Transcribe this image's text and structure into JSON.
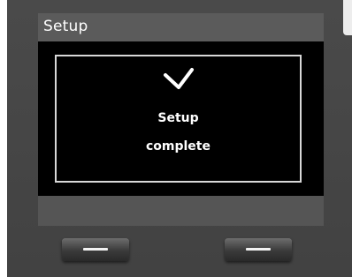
{
  "header": {
    "title": "Setup"
  },
  "dialog": {
    "icon": "checkmark-icon",
    "line1": "Setup",
    "line2": "complete"
  },
  "softkeys": {
    "left_icon": "minus-icon",
    "right_icon": "minus-icon"
  },
  "colors": {
    "display_bg": "#000000",
    "title_bar": "#5b5b5b",
    "housing": "#474747",
    "text": "#ffffff"
  }
}
